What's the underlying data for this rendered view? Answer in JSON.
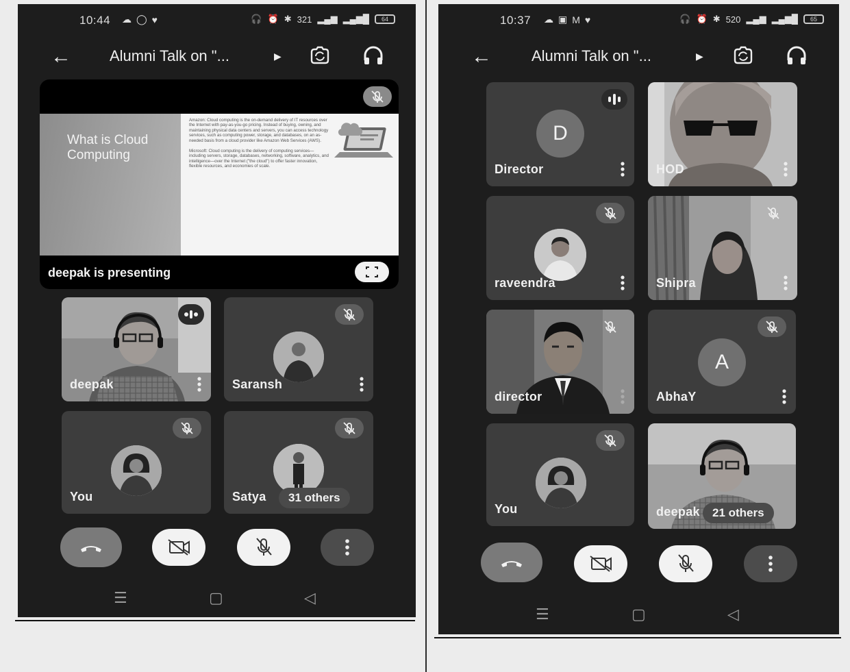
{
  "left_phone": {
    "status": {
      "time": "10:44",
      "speed": "321",
      "battery": "64"
    },
    "appbar": {
      "title": "Alumni Talk on \"..."
    },
    "presentation": {
      "slide_title": "What is Cloud Computing",
      "slide_points": [
        "Amazon: Cloud computing is the on-demand delivery of IT resources over the Internet with pay-as-you-go pricing. Instead of buying, owning, and maintaining physical data centers and servers, you can access technology services, such as computing power, storage, and databases, on an as-needed basis from a cloud provider like Amazon Web Services (AWS).",
        "Microsoft: Cloud computing is the delivery of computing services—including servers, storage, databases, networking, software, analytics, and intelligence—over the Internet (\"the cloud\") to offer faster innovation, flexible resources, and economies of scale."
      ],
      "caption": "deepak is presenting"
    },
    "participants": [
      {
        "name": "deepak"
      },
      {
        "name": "Saransh"
      },
      {
        "name": "You"
      },
      {
        "name": "Satya"
      }
    ],
    "others": "31 others"
  },
  "right_phone": {
    "status": {
      "time": "10:37",
      "speed": "520",
      "battery": "65"
    },
    "appbar": {
      "title": "Alumni Talk on \"..."
    },
    "participants": [
      {
        "name": "Director",
        "initial": "D"
      },
      {
        "name": "HOD"
      },
      {
        "name": "raveendra"
      },
      {
        "name": "Shipra"
      },
      {
        "name": "director"
      },
      {
        "name": "AbhaY",
        "initial": "A"
      },
      {
        "name": "You"
      },
      {
        "name": "deepak"
      }
    ],
    "others": "21 others"
  }
}
